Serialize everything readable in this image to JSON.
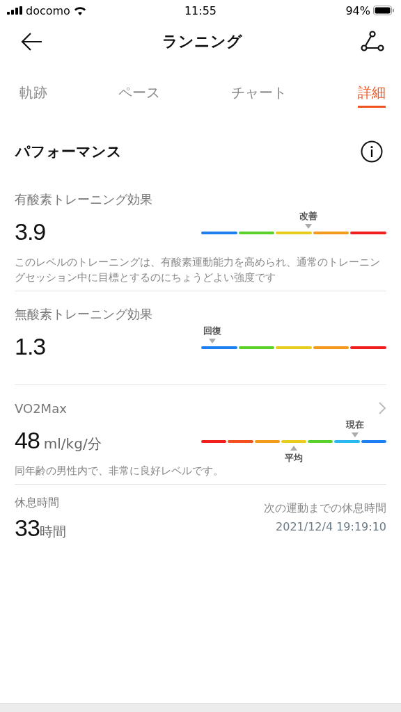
{
  "status_bar": {
    "carrier": "docomo",
    "time": "11:55",
    "battery": "94%"
  },
  "header": {
    "title": "ランニング"
  },
  "tabs": [
    {
      "label": "軌跡",
      "selected": false
    },
    {
      "label": "ペース",
      "selected": false
    },
    {
      "label": "チャート",
      "selected": false
    },
    {
      "label": "詳細",
      "selected": true
    }
  ],
  "section": {
    "title": "パフォーマンス"
  },
  "metrics": [
    {
      "kind": "gauge",
      "label": "有酸素トレーニング効果",
      "value": "3.9",
      "segments": [
        {
          "color": "#1e7ff0"
        },
        {
          "color": "#5bd22a"
        },
        {
          "color": "#e6cd1e"
        },
        {
          "color": "#f39a1c"
        },
        {
          "color": "#f01e1e"
        }
      ],
      "markers": [
        {
          "label": "改善",
          "kind": "above"
        }
      ],
      "description": "このレベルのトレーニングは、有酸素運動能力を高められ、通常のトレーニングセッション中に目標とするのにちょうどよい強度です"
    },
    {
      "kind": "gauge",
      "label": "無酸素トレーニング効果",
      "value": "1.3",
      "segments": [
        {
          "color": "#1e7ff0"
        },
        {
          "color": "#5bd22a"
        },
        {
          "color": "#e6cd1e"
        },
        {
          "color": "#f39a1c"
        },
        {
          "color": "#f01e1e"
        }
      ],
      "markers": [
        {
          "label": "回復",
          "kind": "above"
        }
      ]
    },
    {
      "kind": "gauge",
      "label": "VO2Max",
      "link": true,
      "value": "48",
      "unit": "ml/kg/分",
      "segments": [
        {
          "color": "#f01e1e"
        },
        {
          "color": "#f2501e"
        },
        {
          "color": "#f39a1c"
        },
        {
          "color": "#e6cd1e"
        },
        {
          "color": "#5bd22a"
        },
        {
          "color": "#2ab8f0"
        },
        {
          "color": "#1e7ff0"
        }
      ],
      "markers": [
        {
          "label": "現在",
          "kind": "above"
        },
        {
          "label": "平均",
          "kind": "below"
        }
      ],
      "description": "同年齢の男性内で、非常に良好レベルです。"
    },
    {
      "kind": "rest",
      "label": "休息時間",
      "value": "33",
      "unit": "時間",
      "side_label": "次の運動までの休息時間",
      "side_value": "2021/12/4 19:19:10"
    }
  ]
}
